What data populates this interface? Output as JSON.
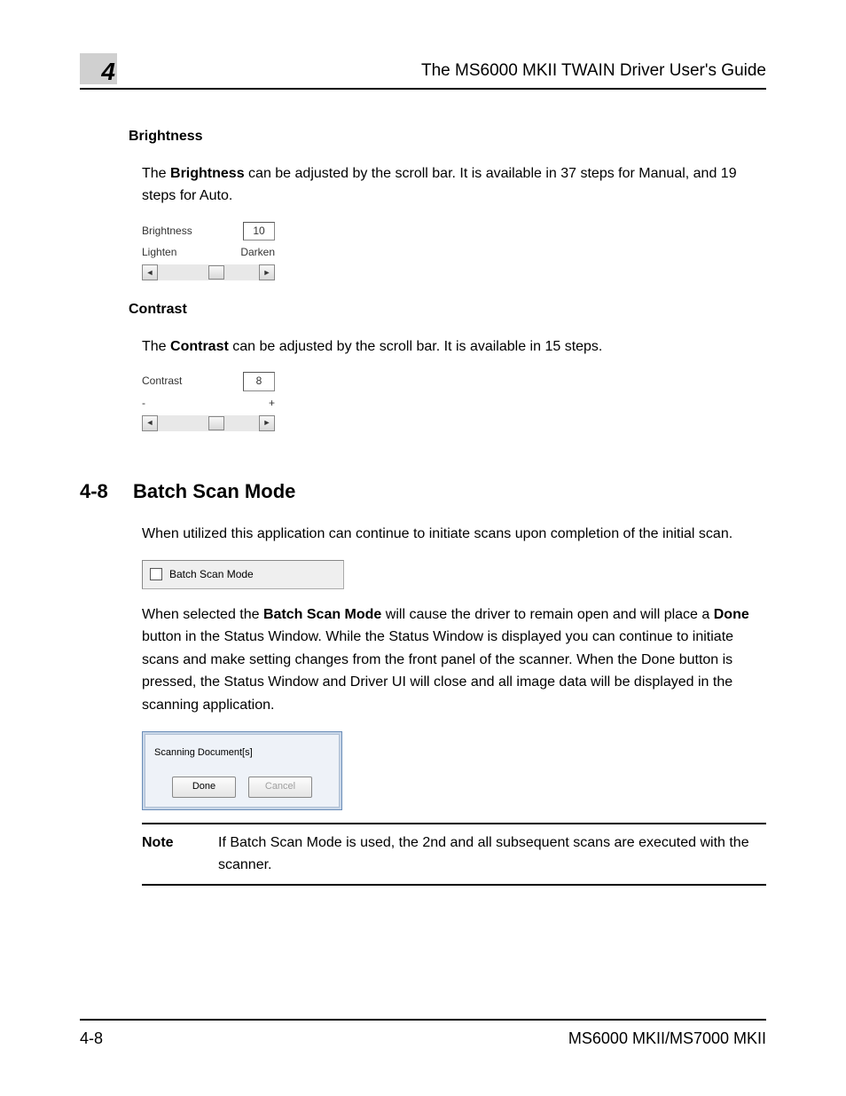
{
  "header": {
    "chapter": "4",
    "title": "The MS6000 MKII TWAIN Driver User's Guide"
  },
  "brightness": {
    "heading": "Brightness",
    "para_prefix": "The ",
    "para_bold": "Brightness",
    "para_suffix": " can be adjusted by the scroll bar. It is available in 37 steps for Manual, and 19 steps for Auto.",
    "ui": {
      "label": "Brightness",
      "value": "10",
      "left": "Lighten",
      "right": "Darken"
    }
  },
  "contrast": {
    "heading": "Contrast",
    "para_prefix": "The ",
    "para_bold": "Contrast",
    "para_suffix": " can be adjusted by the scroll bar. It is available in 15 steps.",
    "ui": {
      "label": "Contrast",
      "value": "8",
      "left": "-",
      "right": "+"
    }
  },
  "batch": {
    "secnum": "4-8",
    "sectitle": "Batch Scan Mode",
    "intro": "When utilized this application can continue to initiate scans upon completion of the initial scan.",
    "checkbox_label": "Batch Scan Mode",
    "para2_a": "When selected the ",
    "para2_b": "Batch Scan Mode",
    "para2_c": " will cause the driver to remain open and will place a ",
    "para2_d": "Done",
    "para2_e": " button in the Status Window. While the Status Window is displayed you can continue to initiate scans and make setting changes from the front panel of the scanner. When the Done button is pressed, the Status Window and Driver UI will close and all image data will be displayed in the scanning application.",
    "dialog": {
      "status": "Scanning Document[s]",
      "done": "Done",
      "cancel": "Cancel"
    },
    "note_label": "Note",
    "note_text": "If Batch Scan Mode is used, the 2nd and all subsequent scans are executed with the scanner."
  },
  "footer": {
    "left": "4-8",
    "right": "MS6000 MKII/MS7000 MKII"
  }
}
